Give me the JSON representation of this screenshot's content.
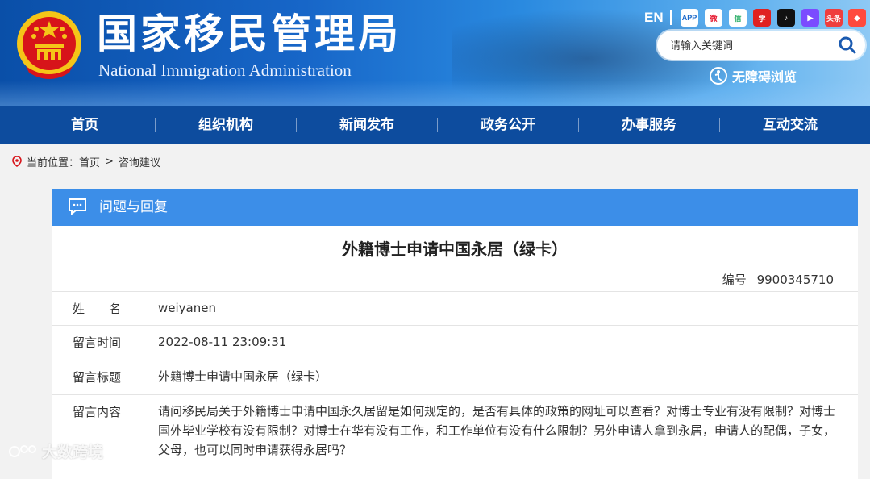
{
  "header": {
    "title": "国家移民管理局",
    "subtitle": "National Immigration Administration",
    "lang": "EN",
    "social": [
      {
        "name": "app-icon",
        "glyph": "APP",
        "color": "#ffffff",
        "fg": "#1766c8"
      },
      {
        "name": "weibo-icon",
        "glyph": "微",
        "color": "#ffffff",
        "fg": "#e6162d"
      },
      {
        "name": "wechat-icon",
        "glyph": "信",
        "color": "#ffffff",
        "fg": "#2aae67"
      },
      {
        "name": "xuexi-icon",
        "glyph": "学",
        "color": "#e02020",
        "fg": "#ffffff"
      },
      {
        "name": "douyin-icon",
        "glyph": "♪",
        "color": "#111111",
        "fg": "#ffffff"
      },
      {
        "name": "video-icon",
        "glyph": "▶",
        "color": "#7b4bff",
        "fg": "#ffffff"
      },
      {
        "name": "toutiao-icon",
        "glyph": "头条",
        "color": "#ef3e3e",
        "fg": "#ffffff"
      },
      {
        "name": "kuaishou-icon",
        "glyph": "◆",
        "color": "#ff4a3d",
        "fg": "#ffffff"
      }
    ],
    "search_placeholder": "请输入关键词",
    "accessibility": "无障碍浏览"
  },
  "nav": [
    "首页",
    "组织机构",
    "新闻发布",
    "政务公开",
    "办事服务",
    "互动交流"
  ],
  "breadcrumb": {
    "label": "当前位置：",
    "items": [
      "首页",
      "咨询建议"
    ],
    "sep": ">"
  },
  "panel": {
    "heading": "问题与回复",
    "question_title": "外籍博士申请中国永居（绿卡）",
    "number_label": "编号",
    "number": "9900345710",
    "rows": [
      {
        "label": "姓　　名",
        "value": "weiyanen"
      },
      {
        "label": "留言时间",
        "value": "2022-08-11 23:09:31"
      },
      {
        "label": "留言标题",
        "value": "外籍博士申请中国永居（绿卡）"
      },
      {
        "label": "留言内容",
        "value": "请问移民局关于外籍博士申请中国永久居留是如何规定的，是否有具体的政策的网址可以查看？对博士专业有没有限制？对博士国外毕业学校有没有限制？对博士在华有没有工作，和工作单位有没有什么限制？另外申请人拿到永居，申请人的配偶，子女，父母，也可以同时申请获得永居吗？"
      }
    ]
  },
  "watermark": "大数跨境",
  "colors": {
    "nav": "#0d4c9e",
    "panel_head": "#3c8ee8",
    "emblem_red": "#d7141a",
    "emblem_gold": "#f5c518"
  }
}
